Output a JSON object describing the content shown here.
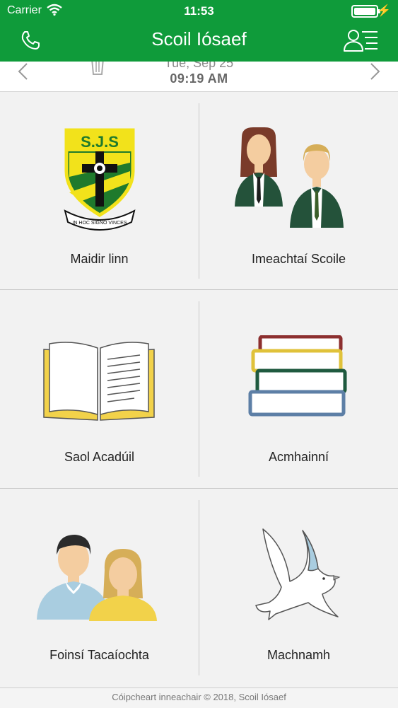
{
  "status_bar": {
    "carrier": "Carrier",
    "time": "11:53",
    "bolt": "⚡"
  },
  "header": {
    "title": "Scoil Iósaef"
  },
  "date_bar": {
    "date": "Tue, Sep 25",
    "time": "09:19 AM"
  },
  "tiles": [
    {
      "label": "Maidir linn"
    },
    {
      "label": "Imeachtaí Scoile"
    },
    {
      "label": "Saol Acadúil"
    },
    {
      "label": "Acmhainní"
    },
    {
      "label": "Foinsí Tacaíochta"
    },
    {
      "label": "Machnamh"
    }
  ],
  "logo": {
    "text": "S.J.S",
    "motto": "IN HOC SIGNO VINCES"
  },
  "footer": {
    "text": "Cóipcheart inneachair © 2018, Scoil Iósaef"
  },
  "colors": {
    "brand_green": "#0f9b3a",
    "crest_yellow": "#f2e21b",
    "crest_green": "#1f7a2c"
  }
}
